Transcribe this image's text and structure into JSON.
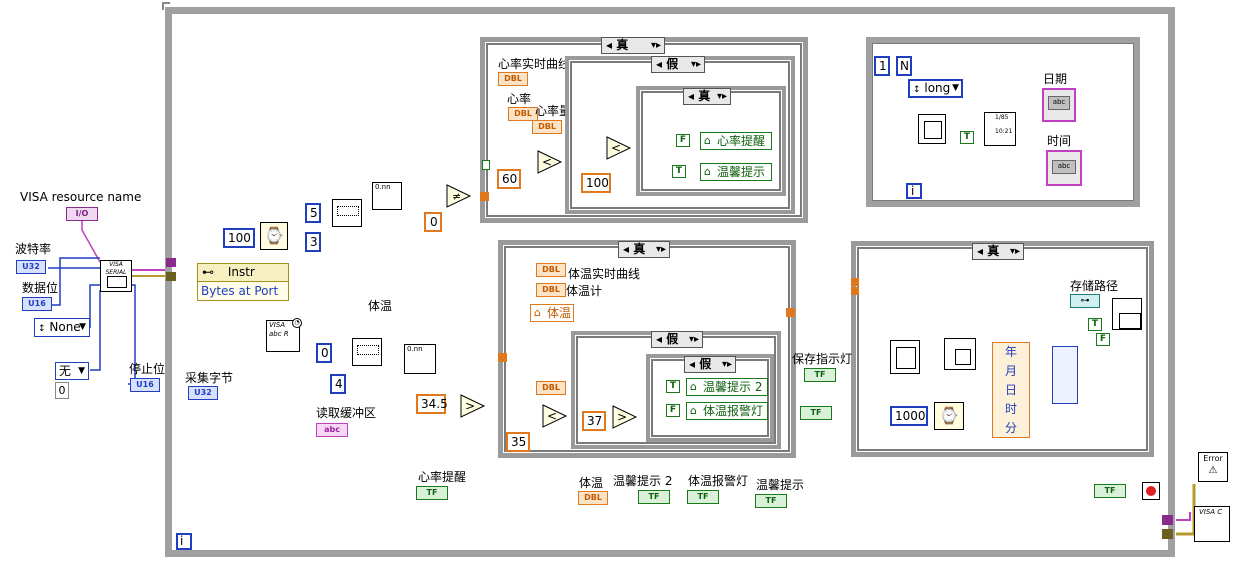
{
  "visa": {
    "resource_label": "VISA resource name",
    "resource_term": "I/O",
    "baud_label": "波特率",
    "baud_term": "U32",
    "databits_label": "数据位",
    "databits_term": "U16",
    "parity_value": "None",
    "stopbits_label": "停止位",
    "stopbits_term": "U16",
    "flow_value": "无",
    "flow_num": "0",
    "serial_icon": "VISA SERIAL"
  },
  "prop_node": {
    "class": "Instr",
    "property": "Bytes at Port"
  },
  "wait": {
    "ms": "100"
  },
  "acq_label": "采集字节",
  "acq_term": "U32",
  "read_label": "读取缓冲区",
  "read_term": "abc",
  "read_icon": "VISA abc R",
  "subset": {
    "offset1": "5",
    "len1": "3",
    "offset2": "0",
    "len2": "4",
    "const0": "0"
  },
  "heart": {
    "case_true": "真",
    "case_false": "假",
    "chart_label": "心率实时曲线",
    "hr_label": "心率",
    "gauge_label": "心率量表",
    "thr_low": "60",
    "thr_high": "100",
    "inner_case": "真",
    "alert_local": "心率提醒",
    "tip_local": "温馨提示",
    "F": "F",
    "T": "T"
  },
  "temp": {
    "case_true": "真",
    "case_false": "假",
    "chart_label": "体温实时曲线",
    "meter_label": "体温计",
    "local_temp": "体温",
    "label_body": "体温",
    "thr_345": "34.5",
    "thr_35": "35",
    "thr_37": "37",
    "inner_false": "假",
    "tip2_local": "温馨提示 2",
    "alarm_local": "体温报警灯",
    "T": "T",
    "F": "F"
  },
  "save": {
    "case_true": "真",
    "indicator_label": "保存指示灯",
    "path_label": "存储路径",
    "wait_ms": "1000",
    "date_parts": [
      "年",
      "月",
      "日",
      "时",
      "分"
    ],
    "T": "T",
    "F": "F"
  },
  "datetime_loop": {
    "n_const": "1",
    "n_term": "N",
    "format": "long",
    "date_label": "日期",
    "time_label": "时间",
    "iter": "i",
    "fmt1": "1/85",
    "fmt2": "10:21"
  },
  "bottom_terms": [
    {
      "label": "心率提醒",
      "term": "TF"
    },
    {
      "label": "体温",
      "term": "DBL"
    },
    {
      "label": "温馨提示 2",
      "term": "TF"
    },
    {
      "label": "体温报警灯",
      "term": "TF"
    },
    {
      "label": "温馨提示",
      "term": "TF"
    }
  ],
  "main_loop": {
    "iter": "i",
    "stop_term": "TF"
  },
  "error": {
    "label": "Error",
    "close_icon": "VISA C"
  },
  "colors": {
    "wire_pink": "#c040c0",
    "wire_orange": "#e0781e",
    "wire_blue": "#1f3fbf",
    "wire_green": "#1a7a1a",
    "wire_gold": "#b89a2a",
    "frame": "#a0a0a0"
  }
}
